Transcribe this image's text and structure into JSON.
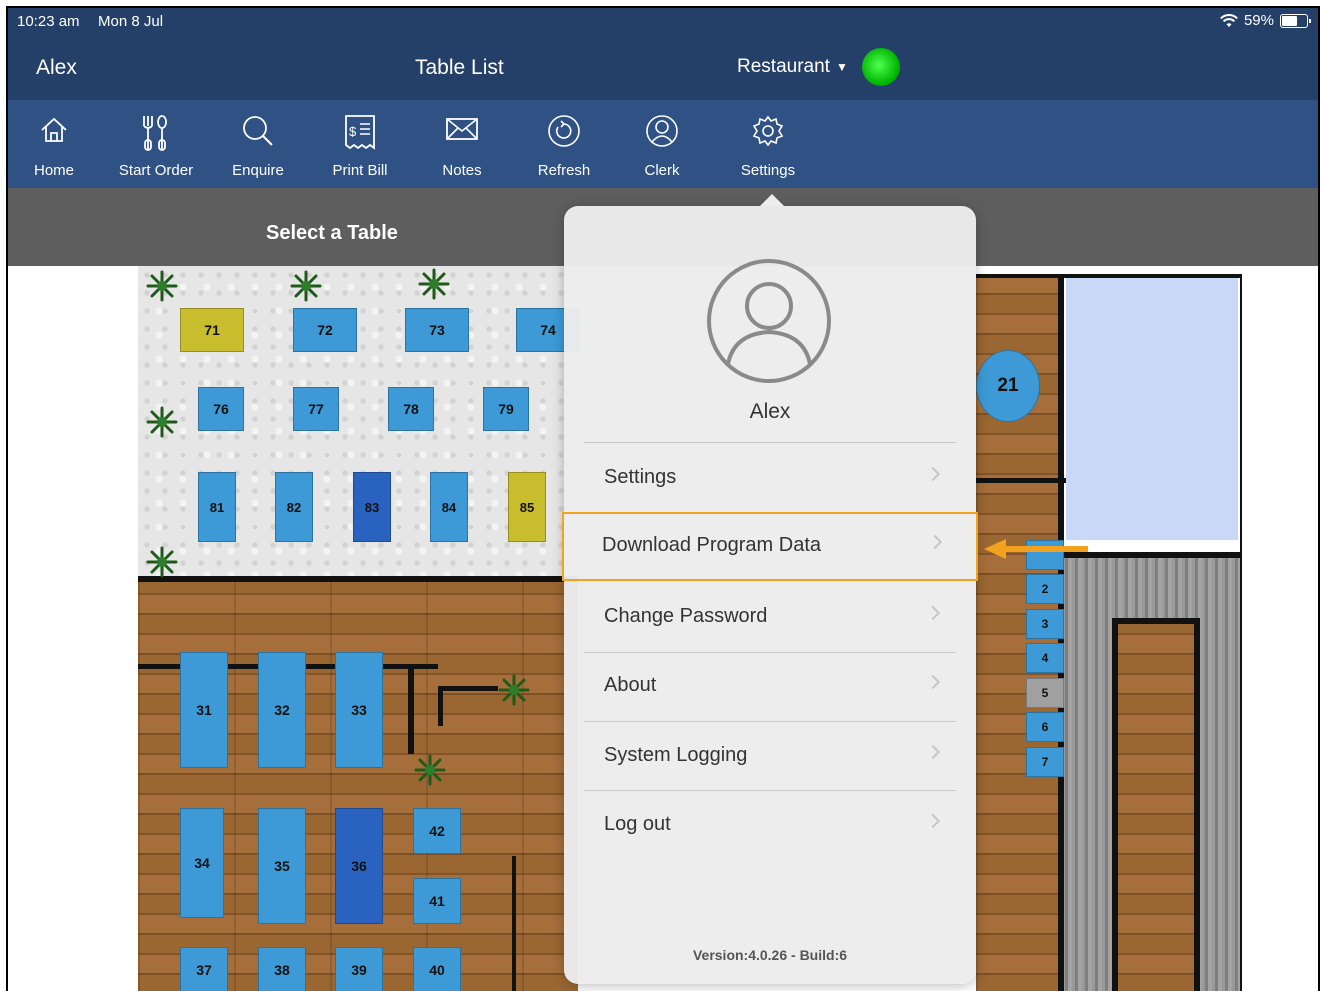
{
  "status_bar": {
    "time": "10:23 am",
    "date": "Mon 8 Jul",
    "battery": "59%",
    "battery_level": 0.59
  },
  "title_bar": {
    "user": "Alex",
    "title": "Table List",
    "venue": "Restaurant"
  },
  "toolbar": [
    {
      "label": "Home",
      "icon": "home-icon"
    },
    {
      "label": "Start Order",
      "icon": "cutlery-icon"
    },
    {
      "label": "Enquire",
      "icon": "search-icon"
    },
    {
      "label": "Print Bill",
      "icon": "bill-icon"
    },
    {
      "label": "Notes",
      "icon": "envelope-icon"
    },
    {
      "label": "Refresh",
      "icon": "refresh-icon"
    },
    {
      "label": "Clerk",
      "icon": "user-circle-icon"
    },
    {
      "label": "Settings",
      "icon": "gear-icon"
    }
  ],
  "select_bar": {
    "label": "Select a Table"
  },
  "tables": {
    "t71": "71",
    "t72": "72",
    "t73": "73",
    "t74": "74",
    "t76": "76",
    "t77": "77",
    "t78": "78",
    "t79": "79",
    "t81": "81",
    "t82": "82",
    "t83": "83",
    "t84": "84",
    "t85": "85",
    "t31": "31",
    "t32": "32",
    "t33": "33",
    "t34": "34",
    "t35": "35",
    "t36": "36",
    "t37": "37",
    "t38": "38",
    "t39": "39",
    "t40": "40",
    "t41": "41",
    "t42": "42",
    "t21": "21",
    "t2": "2",
    "t3": "3",
    "t4": "4",
    "t5": "5",
    "t6": "6",
    "t7": "7"
  },
  "popover": {
    "user_name": "Alex",
    "menu": [
      {
        "label": "Settings"
      },
      {
        "label": "Download Program Data",
        "highlighted": true
      },
      {
        "label": "Change Password"
      },
      {
        "label": "About"
      },
      {
        "label": "System Logging"
      },
      {
        "label": "Log out"
      }
    ],
    "version": "Version:4.0.26 - Build:6"
  },
  "colors": {
    "header": "#244068",
    "toolbar": "#2f5184",
    "highlight": "#f2a21f",
    "table_blue": "#3d9ad6",
    "table_dark_blue": "#2a62c0",
    "table_yellow": "#c8bd2c",
    "status_online": "#00c800"
  }
}
